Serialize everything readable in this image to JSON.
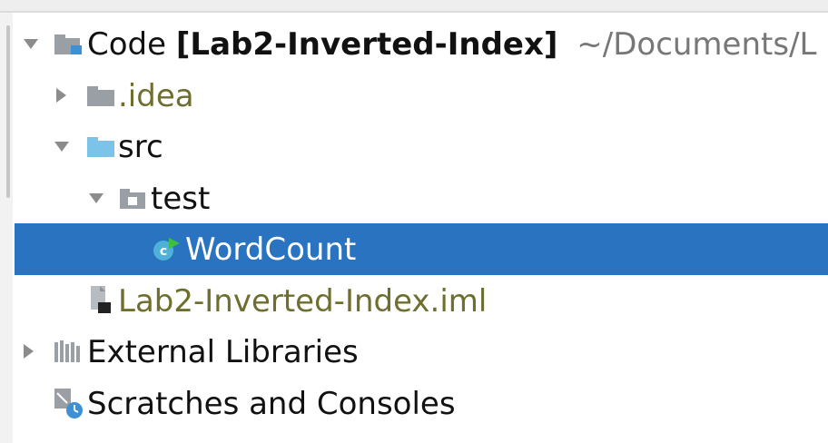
{
  "tree": {
    "root": {
      "name": "Code",
      "module": "[Lab2-Inverted-Index]",
      "path": "~/Documents/L"
    },
    "items": [
      {
        "label": ".idea"
      },
      {
        "label": "src"
      },
      {
        "label": "test"
      },
      {
        "label": "WordCount"
      },
      {
        "label": "Lab2-Inverted-Index.iml"
      },
      {
        "label": "External Libraries"
      },
      {
        "label": "Scratches and Consoles"
      }
    ]
  },
  "colors": {
    "selection": "#2a73c0",
    "excluded_text": "#6e6e2f",
    "folder_blue": "#7bc3e8",
    "folder_gray": "#9a9fa5"
  },
  "icons": {
    "root": "module-folder-icon",
    "idea": "folder-icon",
    "src": "source-folder-icon",
    "test": "package-folder-icon",
    "wordcount": "java-class-icon",
    "iml": "iml-file-icon",
    "libraries": "libraries-icon",
    "scratches": "scratches-icon"
  }
}
